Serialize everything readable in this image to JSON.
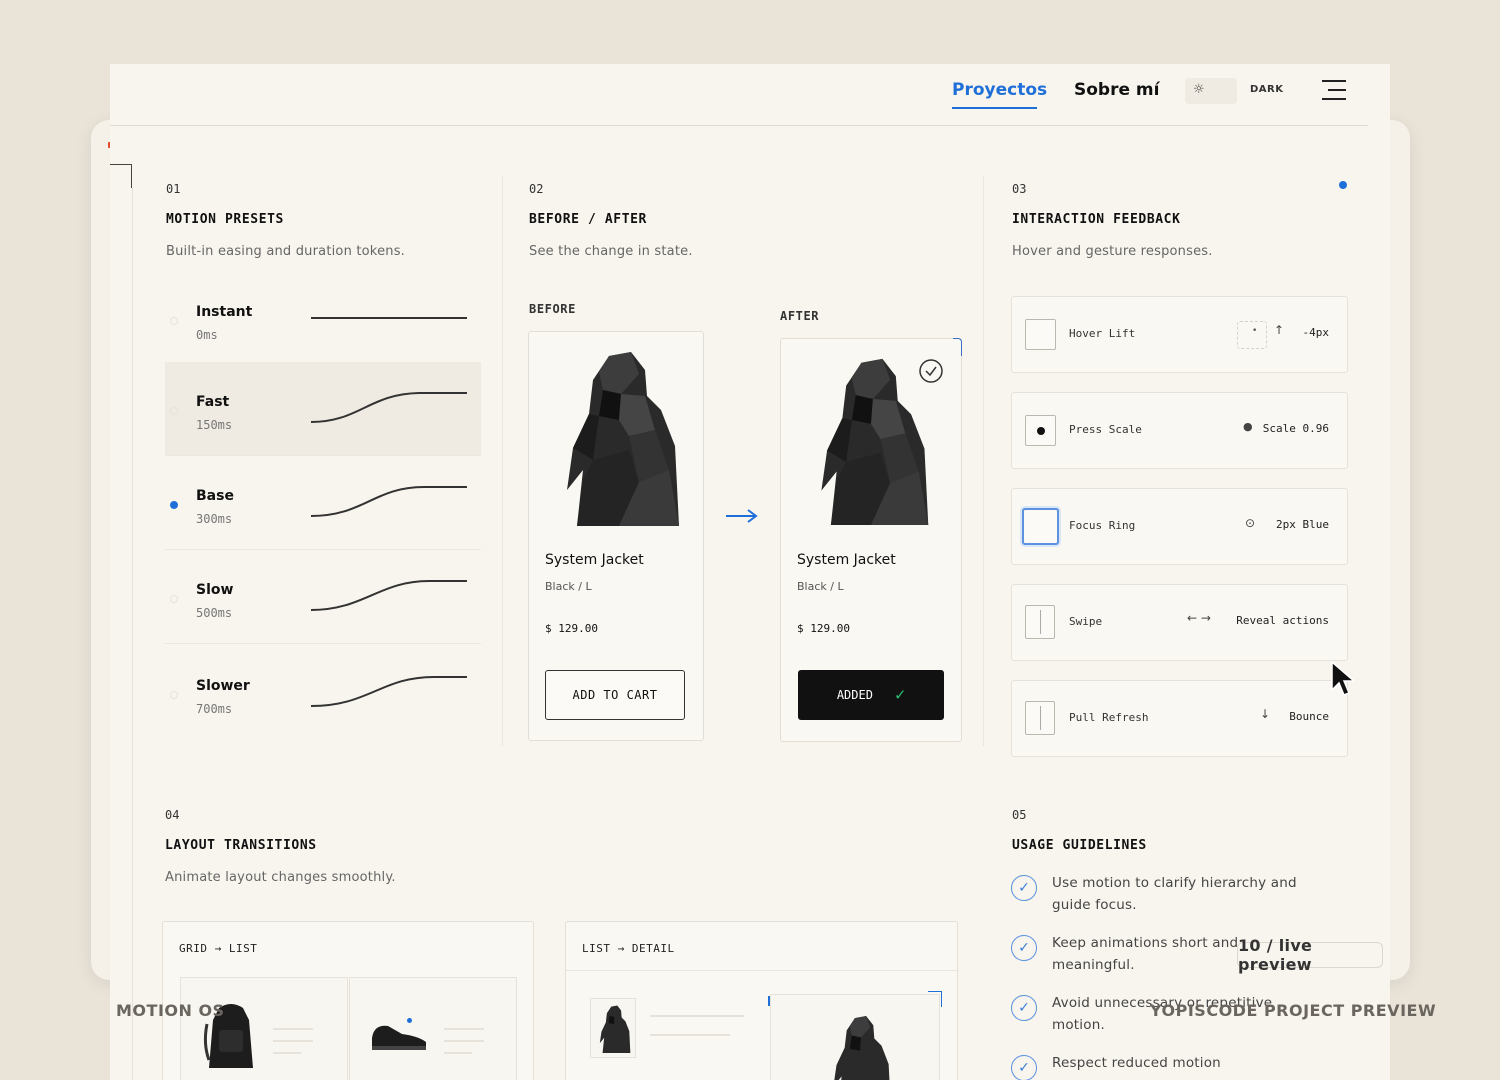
{
  "nav": {
    "links": [
      {
        "label": "Proyectos",
        "active": true
      },
      {
        "label": "Sobre mí",
        "active": false
      }
    ],
    "theme_icon": "sun-icon",
    "theme_label": "DARK",
    "menu_icon": "hamburger-menu-icon"
  },
  "sections": {
    "presets": {
      "number": "01",
      "title": "MOTION PRESETS",
      "subtitle": "Built-in easing and duration tokens.",
      "items": [
        {
          "name": "Instant",
          "time": "0ms",
          "selected": false
        },
        {
          "name": "Fast",
          "time": "150ms",
          "selected": false
        },
        {
          "name": "Base",
          "time": "300ms",
          "selected": true
        },
        {
          "name": "Slow",
          "time": "500ms",
          "selected": false
        },
        {
          "name": "Slower",
          "time": "700ms",
          "selected": false
        }
      ]
    },
    "before_after": {
      "number": "02",
      "title": "BEFORE / AFTER",
      "subtitle": "See the change in state.",
      "before_label": "BEFORE",
      "after_label": "AFTER",
      "before_card": {
        "name": "System Jacket",
        "variant": "Black / L",
        "price": "$ 129.00",
        "button": "ADD TO CART"
      },
      "after_card": {
        "name": "System Jacket",
        "variant": "Black / L",
        "price": "$ 129.00",
        "button": "ADDED"
      }
    },
    "feedback": {
      "number": "03",
      "title": "INTERACTION FEEDBACK",
      "subtitle": "Hover and gesture responses.",
      "items": [
        {
          "label": "Hover Lift",
          "value": "-4px",
          "icon": "arrow-up-icon"
        },
        {
          "label": "Press Scale",
          "value": "Scale 0.96",
          "icon": "dot-icon"
        },
        {
          "label": "Focus Ring",
          "value": "2px Blue",
          "icon": "target-icon"
        },
        {
          "label": "Swipe",
          "value": "Reveal actions",
          "icon": "swipe-arrows-icon"
        },
        {
          "label": "Pull Refresh",
          "value": "Bounce",
          "icon": "arrow-down-icon"
        }
      ]
    },
    "layout": {
      "number": "04",
      "title": "LAYOUT TRANSITIONS",
      "subtitle": "Animate layout changes smoothly.",
      "cards": [
        {
          "label": "GRID → LIST"
        },
        {
          "label": "LIST → DETAIL"
        }
      ]
    },
    "guidelines": {
      "number": "05",
      "title": "USAGE GUIDELINES",
      "items": [
        "Use motion to clarify hierarchy and guide focus.",
        "Keep animations short and meaningful.",
        "Avoid unnecessary or repetitive motion.",
        "Respect reduced motion"
      ]
    }
  },
  "overlay": {
    "badge": "10 / live preview",
    "left_caption": "MOTION OS",
    "right_caption": "YOPISCODE PROJECT PREVIEW"
  },
  "colors": {
    "accent": "#1f6fd8",
    "background": "#e9e3d8",
    "surface": "#f8f5ee",
    "success": "#2fbf71"
  }
}
